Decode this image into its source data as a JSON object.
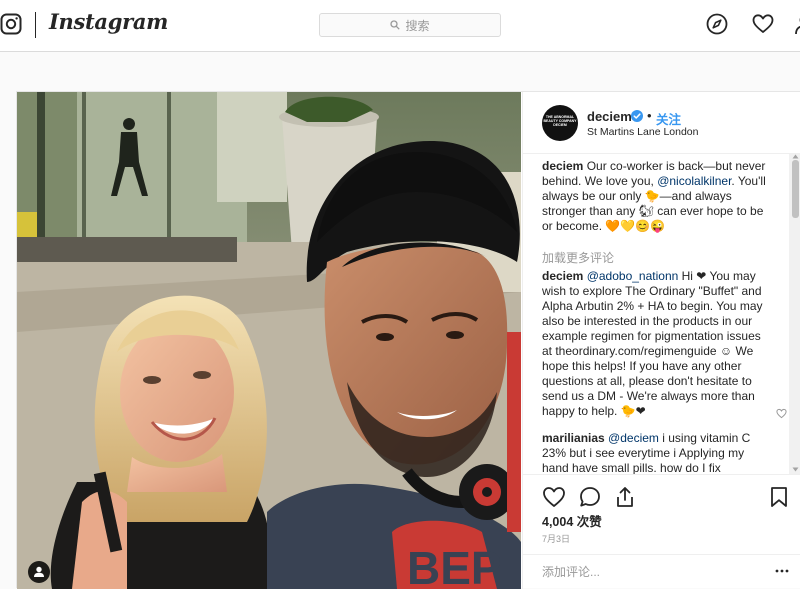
{
  "header": {
    "brand": "Instagram",
    "search_placeholder": "搜索",
    "icons": [
      "instagram-camera-icon",
      "search-icon",
      "explore-compass-icon",
      "heart-icon",
      "profile-icon"
    ]
  },
  "post": {
    "author": {
      "username": "deciem",
      "verified": true,
      "follow_label": "关注",
      "location": "St Martins Lane London",
      "avatar_text": "THE ABNORMAL BEAUTY COMPANY DECIEM"
    },
    "caption": {
      "username": "deciem",
      "text_before": " Our co-worker is back—but never behind. We love you, ",
      "mention": "@nicolalkilner",
      "text_after": ". You'll always be our only 🐤—and always stronger than any 🐿 can ever hope to be or become. 🧡💛😊😜"
    },
    "load_more": "加载更多评论",
    "comments": [
      {
        "username": "deciem",
        "mention": "@adobo_nationn",
        "text": " Hi ❤ You may wish to explore The Ordinary \"Buffet\" and Alpha Arbutin 2% + HA to begin. You may also be interested in the products in our example regimen for pigmentation issues at theordinary.com/regimenguide ☺ We hope this helps! If you have any other questions at all, please don't hesitate to send us a DM - We're always more than happy to help. 🐤❤"
      },
      {
        "username": "marilianias",
        "mention": "@deciem",
        "text": " i using vitamin C 23% but i see everytime i Applying my hand have small pills. how do I fix"
      }
    ],
    "likes": "4,004 次赞",
    "date": "7月3日",
    "add_comment_placeholder": "添加评论...",
    "colors": {
      "link_blue": "#3897f0",
      "mention_blue": "#003569",
      "muted": "#999999",
      "text": "#262626"
    }
  }
}
